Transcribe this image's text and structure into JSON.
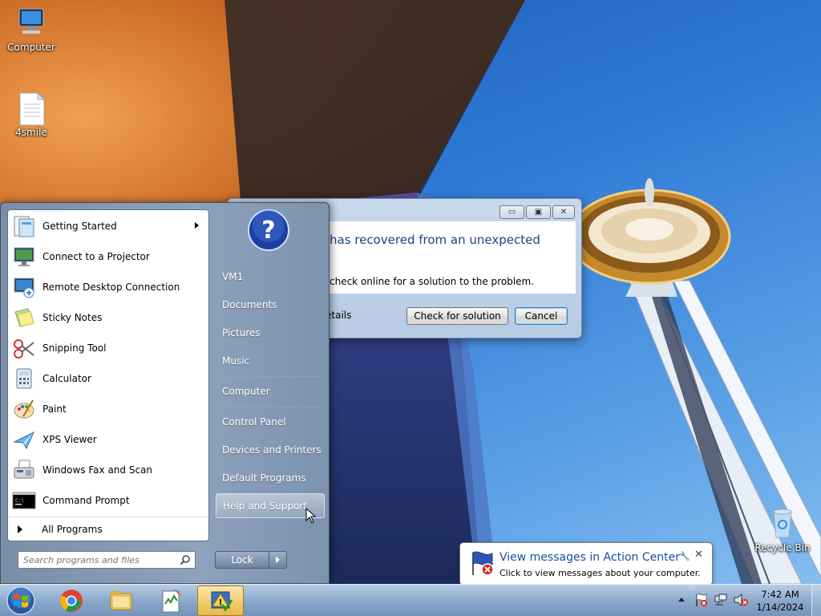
{
  "desktop": {
    "icons": [
      {
        "label": "Computer"
      },
      {
        "label": "4smile"
      },
      {
        "label": "Recycle Bin"
      }
    ]
  },
  "dialog": {
    "heading": "has recovered from an unexpected",
    "message": "check online for a solution to the problem.",
    "details_text": "etails",
    "check_button": "Check for solution",
    "cancel_button": "Cancel",
    "minimize_glyph": "▭",
    "maximize_glyph": "▣",
    "close_glyph": "✕"
  },
  "start_menu": {
    "programs": [
      {
        "label": "Getting Started",
        "icon": "getting-started-icon",
        "has_submenu": true
      },
      {
        "label": "Connect to a Projector",
        "icon": "projector-icon"
      },
      {
        "label": "Remote Desktop Connection",
        "icon": "remote-desktop-icon"
      },
      {
        "label": "Sticky Notes",
        "icon": "sticky-notes-icon"
      },
      {
        "label": "Snipping Tool",
        "icon": "scissors-icon"
      },
      {
        "label": "Calculator",
        "icon": "calculator-icon"
      },
      {
        "label": "Paint",
        "icon": "paint-palette-icon"
      },
      {
        "label": "XPS Viewer",
        "icon": "xps-viewer-icon"
      },
      {
        "label": "Windows Fax and Scan",
        "icon": "fax-icon"
      },
      {
        "label": "Command Prompt",
        "icon": "command-prompt-icon"
      }
    ],
    "all_programs": "All Programs",
    "search_placeholder": "Search programs and files",
    "right_items": [
      {
        "label": "VM1"
      },
      {
        "label": "Documents"
      },
      {
        "label": "Pictures"
      },
      {
        "label": "Music"
      },
      {
        "label": "Computer"
      },
      {
        "label": "Control Panel"
      },
      {
        "label": "Devices and Printers"
      },
      {
        "label": "Default Programs"
      },
      {
        "label": "Help and Support",
        "highlighted": true
      }
    ],
    "lock_label": "Lock"
  },
  "balloon": {
    "title": "View messages in Action Center",
    "subtitle": "Click to view messages about your computer."
  },
  "taskbar": {
    "pinned": [
      "windows-explorer-icon",
      "chrome-icon",
      "file-explorer-icon",
      "notepad-app-icon",
      "action-app-icon"
    ],
    "time": "7:42 AM",
    "date": "1/14/2024"
  },
  "colors": {
    "dialog_heading": "#1e3f86",
    "balloon_title": "#1a4ea1",
    "taskbar": "#91accc",
    "start_menu": "#8da2bb"
  }
}
